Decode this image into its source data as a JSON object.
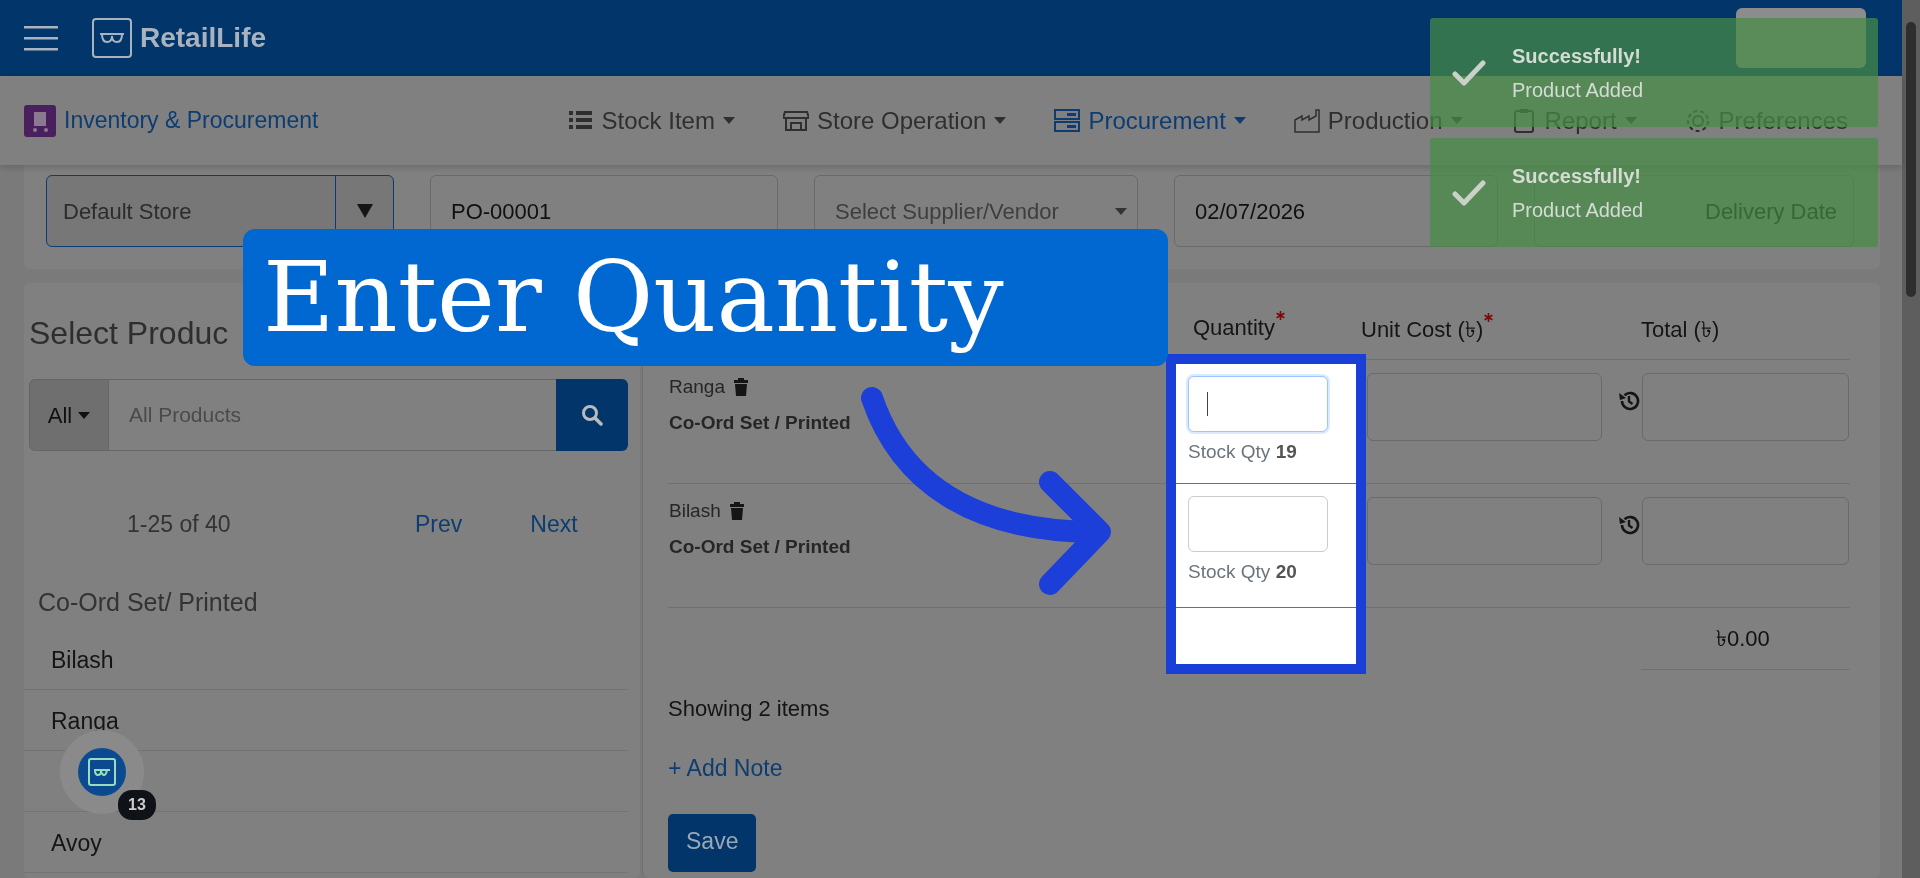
{
  "header": {
    "app_name": "RetailLife"
  },
  "module": {
    "title": "Inventory & Procurement"
  },
  "nav": [
    {
      "label": "Stock Item",
      "dropdown": true,
      "selected": false
    },
    {
      "label": "Store Operation",
      "dropdown": true,
      "selected": false
    },
    {
      "label": "Procurement",
      "dropdown": true,
      "selected": true
    },
    {
      "label": "Production",
      "dropdown": true,
      "selected": false
    },
    {
      "label": "Report",
      "dropdown": true,
      "selected": false
    },
    {
      "label": "Preferences",
      "dropdown": false,
      "selected": false
    }
  ],
  "form": {
    "store": {
      "value": "Default Store"
    },
    "po_number": {
      "value": "PO-00001"
    },
    "supplier": {
      "placeholder": "Select Supplier/Vendor"
    },
    "date": {
      "value": "02/07/2026"
    },
    "delivery_date": {
      "placeholder": "Delivery Date"
    }
  },
  "toasts": [
    {
      "title": "Successfully!",
      "message": "Product Added"
    },
    {
      "title": "Successfully!",
      "message": "Product Added"
    }
  ],
  "product_picker": {
    "title": "Select Produc",
    "filter": "All",
    "search": {
      "placeholder": "All Products"
    },
    "range": "1-25 of 40",
    "prev": "Prev",
    "next": "Next",
    "category": "Co-Ord Set/ Printed",
    "items": [
      {
        "name": "Bilash",
        "covered": false
      },
      {
        "name": "Ranga",
        "covered": false
      },
      {
        "covered": true
      },
      {
        "name": "Avoy",
        "covered": false
      }
    ]
  },
  "order_table": {
    "columns": [
      {
        "label": "Quantity",
        "required": true
      },
      {
        "label": "Unit Cost (৳)",
        "required": true
      },
      {
        "label": "Total (৳)",
        "required": false
      }
    ],
    "rows": [
      {
        "name": "Ranga",
        "category": "Co-Ord Set / Printed",
        "focused": true,
        "stock": "Stock Qty **19**"
      },
      {
        "name": "Bilash",
        "category": "Co-Ord Set / Printed",
        "focused": false,
        "stock": "Stock Qty **20**"
      }
    ],
    "grand_total": "৳0.00",
    "summary": "Showing 2 items",
    "add_note": "+ Add Note",
    "save": "Save"
  },
  "callout": {
    "text": "Enter Quantity"
  },
  "chat_badge": {
    "count": "13"
  }
}
